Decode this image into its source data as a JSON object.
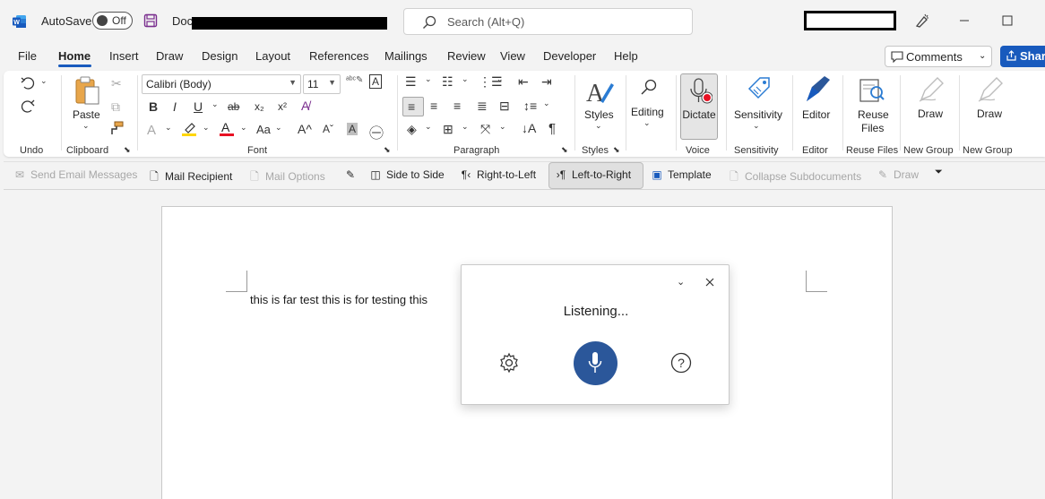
{
  "titlebar": {
    "autosave_label": "AutoSave",
    "autosave_state": "Off",
    "doc_title_prefix": "Doc",
    "search_placeholder": "Search (Alt+Q)"
  },
  "tabs": [
    "File",
    "Home",
    "Insert",
    "Draw",
    "Design",
    "Layout",
    "References",
    "Mailings",
    "Review",
    "View",
    "Developer",
    "Help"
  ],
  "active_tab": "Home",
  "comments_label": "Comments",
  "share_label": "Share",
  "ribbon": {
    "paste_label": "Paste",
    "font_name": "Calibri (Body)",
    "font_size": "11",
    "styles_label": "Styles",
    "editing_label": "Editing",
    "dictate_label": "Dictate",
    "sensitivity_label": "Sensitivity",
    "editor_label": "Editor",
    "reuse_label_1": "Reuse",
    "reuse_label_2": "Files",
    "draw_label_1": "Draw",
    "draw_label_2": "Draw",
    "groups": {
      "undo": "Undo",
      "clipboard": "Clipboard",
      "font": "Font",
      "paragraph": "Paragraph",
      "styles": "Styles",
      "voice": "Voice",
      "sensitivity": "Sensitivity",
      "editor": "Editor",
      "reuse": "Reuse Files",
      "new_group_1": "New Group",
      "new_group_2": "New Group"
    }
  },
  "qat": {
    "send_email": "Send Email Messages",
    "mail_recipient": "Mail Recipient",
    "mail_options": "Mail Options",
    "side_to_side": "Side to Side",
    "rtl": "Right-to-Left",
    "ltr": "Left-to-Right",
    "template": "Template",
    "collapse": "Collapse Subdocuments",
    "draw": "Draw"
  },
  "document": {
    "body_text": "this is far test this is for testing this"
  },
  "dictation": {
    "status": "Listening..."
  },
  "colors": {
    "accent": "#185abd",
    "mic": "#2b579a",
    "dictate_rec": "#e81123"
  }
}
